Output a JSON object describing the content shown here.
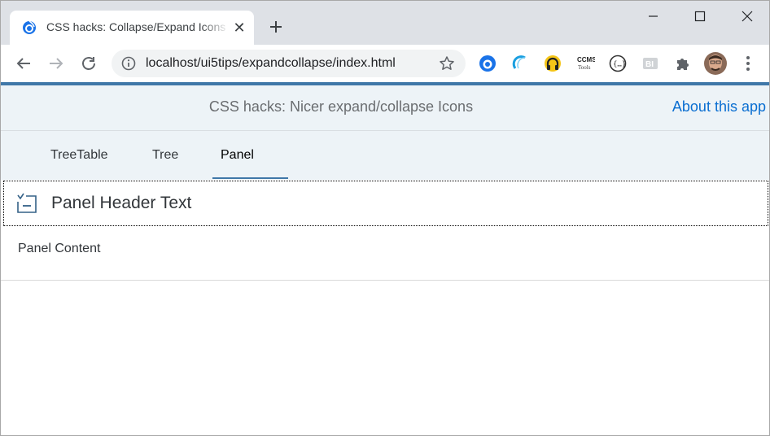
{
  "browser": {
    "tab": {
      "title": "CSS hacks: Collapse/Expand Icons",
      "close_glyph": "✕",
      "favicon": "openui5-icon"
    },
    "new_tab_icon": "plus-icon",
    "window_controls": [
      "minimize-icon",
      "maximize-icon",
      "close-icon"
    ],
    "address_bar": {
      "url": "localhost/ui5tips/expandcollapse/index.html",
      "info_icon": "info-icon",
      "bookmark_icon": "star-icon"
    },
    "extensions": [
      "openui5-ext-icon",
      "ui5-inspector-icon",
      "headphones-ext-icon",
      "ccm-tools-icon",
      "json-viewer-icon",
      "bi-ext-icon",
      "puzzle-icon"
    ]
  },
  "app": {
    "title": "CSS hacks: Nicer expand/collapse Icons",
    "about_link": "About this app",
    "tabs": [
      {
        "label": "TreeTable"
      },
      {
        "label": "Tree"
      },
      {
        "label": "Panel"
      }
    ],
    "selected_tab": "Panel",
    "panel": {
      "header": "Panel Header Text",
      "content": "Panel Content"
    }
  },
  "colors": {
    "accent": "#3f77a8",
    "link": "#0a6ed1",
    "shell_bg": "#edf3f7"
  }
}
